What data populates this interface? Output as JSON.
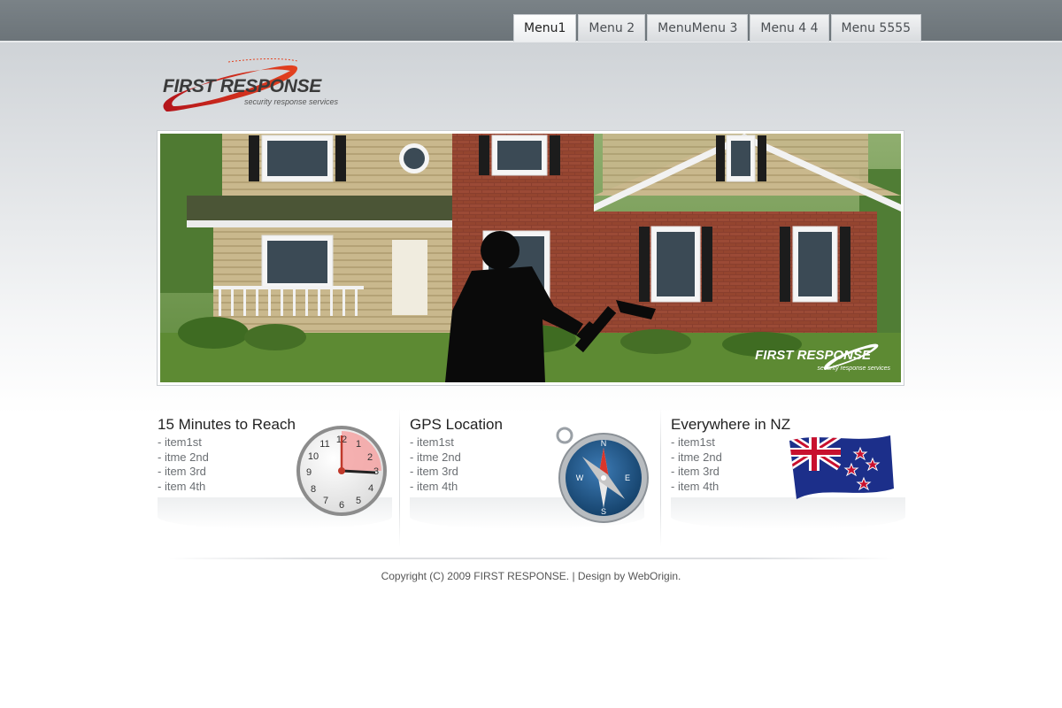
{
  "nav": {
    "tabs": [
      {
        "label": "Menu1"
      },
      {
        "label": "Menu 2"
      },
      {
        "label": "MenuMenu 3"
      },
      {
        "label": "Menu 4 4"
      },
      {
        "label": "Menu 5555"
      }
    ]
  },
  "brand": {
    "name": "FIRST RESPONSE",
    "tagline": "security response services",
    "accent_color": "#cc1f1f"
  },
  "banner": {
    "logo_name": "FIRST RESPONSE",
    "logo_tagline": "security response services"
  },
  "features": [
    {
      "title": "15 Minutes to Reach",
      "items": [
        "- item1st",
        "- itme 2nd",
        "- item 3rd",
        "- item 4th"
      ],
      "icon": "clock-icon"
    },
    {
      "title": "GPS Location",
      "items": [
        "- item1st",
        "- itme 2nd",
        "- item 3rd",
        "- item 4th"
      ],
      "icon": "compass-icon"
    },
    {
      "title": "Everywhere in NZ",
      "items": [
        "- item1st",
        "- itme 2nd",
        "- item 3rd",
        "- item 4th"
      ],
      "icon": "nz-flag-icon"
    }
  ],
  "clock_numbers": [
    "12",
    "1",
    "2",
    "3",
    "4",
    "5",
    "6",
    "7",
    "8",
    "9",
    "10",
    "11"
  ],
  "footer": {
    "text": "Copyright (C) 2009 FIRST RESPONSE. | Design by WebOrigin."
  }
}
